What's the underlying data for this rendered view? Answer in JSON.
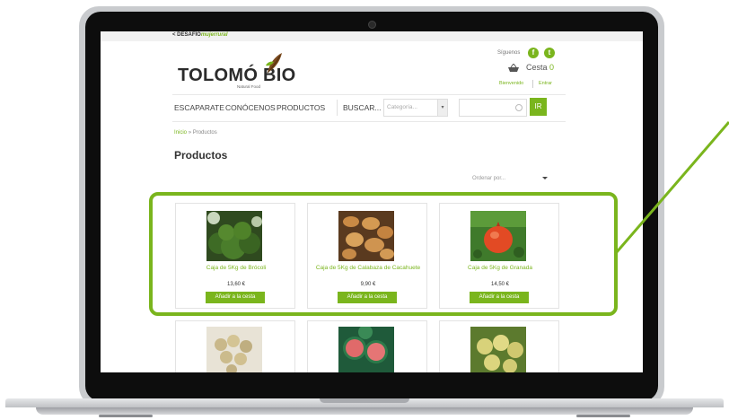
{
  "site": {
    "back_prefix": "< DESAFÍO",
    "back_brand_a": "mujer",
    "back_brand_b": "rural",
    "logo_text_a": "TOLOMÓ",
    "logo_text_b": " BIO",
    "logo_sub": "Natural Food"
  },
  "header": {
    "follow_label": "Síguenos",
    "facebook_glyph": "f",
    "twitter_glyph": "t",
    "cart_label": "Cesta",
    "cart_count": "0",
    "welcome_label": "Bienvenido",
    "login_label": "Entrar"
  },
  "nav": {
    "items": [
      "ESCAPARATE",
      "CONÓCENOS",
      "PRODUCTOS",
      "BUSCAR..."
    ],
    "category_placeholder": "Categoría...",
    "go_label": "IR"
  },
  "breadcrumb": {
    "home": "Inicio",
    "separator": "»",
    "current": "Productos"
  },
  "page": {
    "title": "Productos",
    "sort_label": "Ordenar por..."
  },
  "products": [
    {
      "title": "Caja de 5Kg de Brócoli",
      "price": "13,60 €",
      "button": "Añadir a la cesta"
    },
    {
      "title": "Caja de 5Kg de Calabaza de Cacahuete",
      "price": "9,90 €",
      "button": "Añadir a la cesta"
    },
    {
      "title": "Caja de 5Kg de Granada",
      "price": "14,50 €",
      "button": "Añadir a la cesta"
    }
  ],
  "colors": {
    "accent": "#7ab51d",
    "text": "#333333"
  }
}
